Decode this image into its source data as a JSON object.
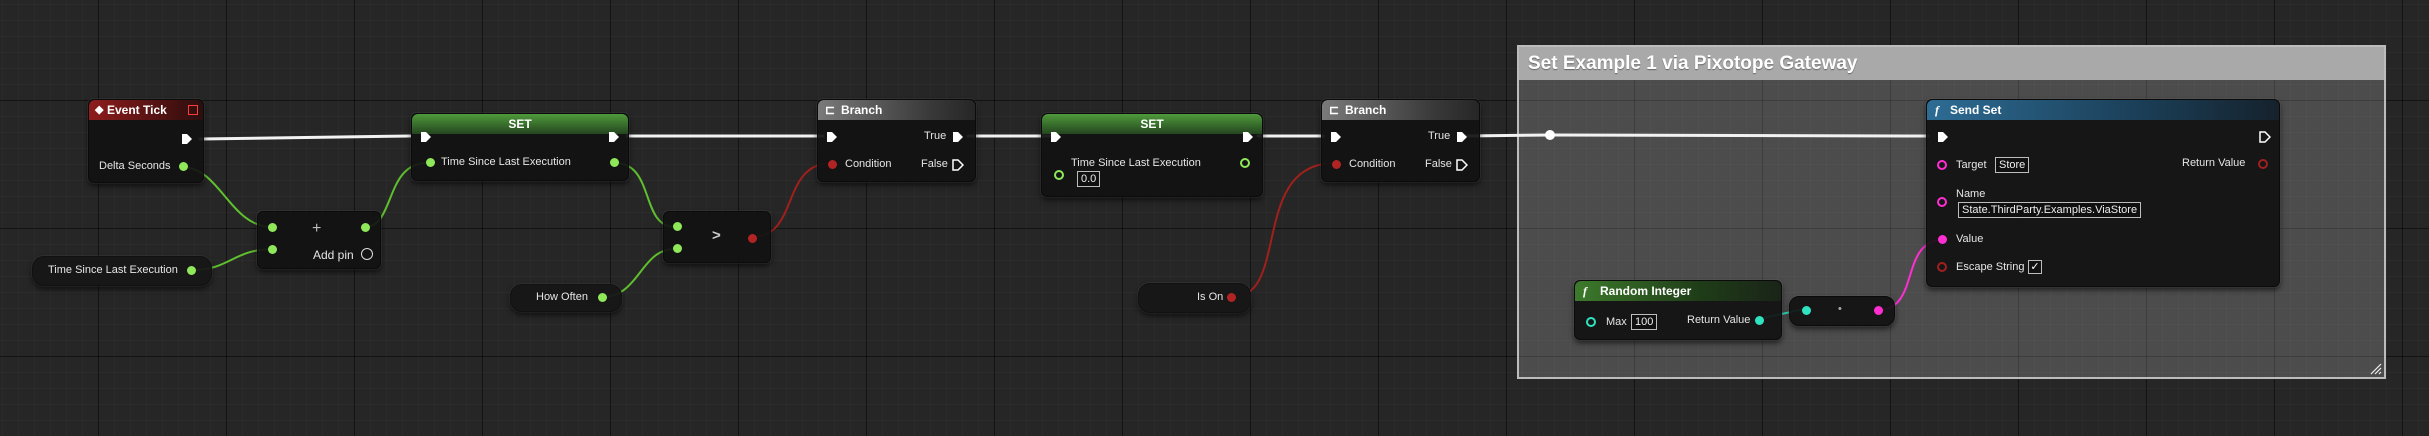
{
  "colors": {
    "exec": "#ffffff",
    "float": "#8ee85a",
    "bool": "#a02020",
    "int": "#2fe3c0",
    "string": "#ff2ed3",
    "object": "#2d8fd0"
  },
  "comment": {
    "title": "Set Example 1 via Pixotope Gateway"
  },
  "event_tick": {
    "title": "Event Tick",
    "pin_delta": "Delta Seconds",
    "icon": "event-diamond-icon"
  },
  "var_time_since": {
    "label": "Time Since Last Execution"
  },
  "add_node": {
    "add_pin_label": "Add pin",
    "plus_icon": "+"
  },
  "set1": {
    "title": "SET",
    "pin": "Time Since Last Execution"
  },
  "how_often": {
    "label": "How Often"
  },
  "greater": {
    "symbol": ">"
  },
  "branch1": {
    "title": "Branch",
    "cond": "Condition",
    "true": "True",
    "false": "False"
  },
  "set2": {
    "title": "SET",
    "pin": "Time Since Last Execution",
    "value": "0.0"
  },
  "branch2": {
    "title": "Branch",
    "cond": "Condition",
    "true": "True",
    "false": "False"
  },
  "is_on": {
    "label": "Is On"
  },
  "random_integer": {
    "title": "Random Integer",
    "max_label": "Max",
    "max_value": "100",
    "return": "Return Value",
    "func_icon": "f"
  },
  "conv": {
    "dot": "•"
  },
  "send_set": {
    "title": "Send Set",
    "func_icon": "f",
    "target_label": "Target",
    "target_value": "Store",
    "return": "Return Value",
    "name_label": "Name",
    "name_value": "State.ThirdParty.Examples.ViaStore",
    "value_label": "Value",
    "escape_label": "Escape String",
    "escape_checked": "✓"
  }
}
